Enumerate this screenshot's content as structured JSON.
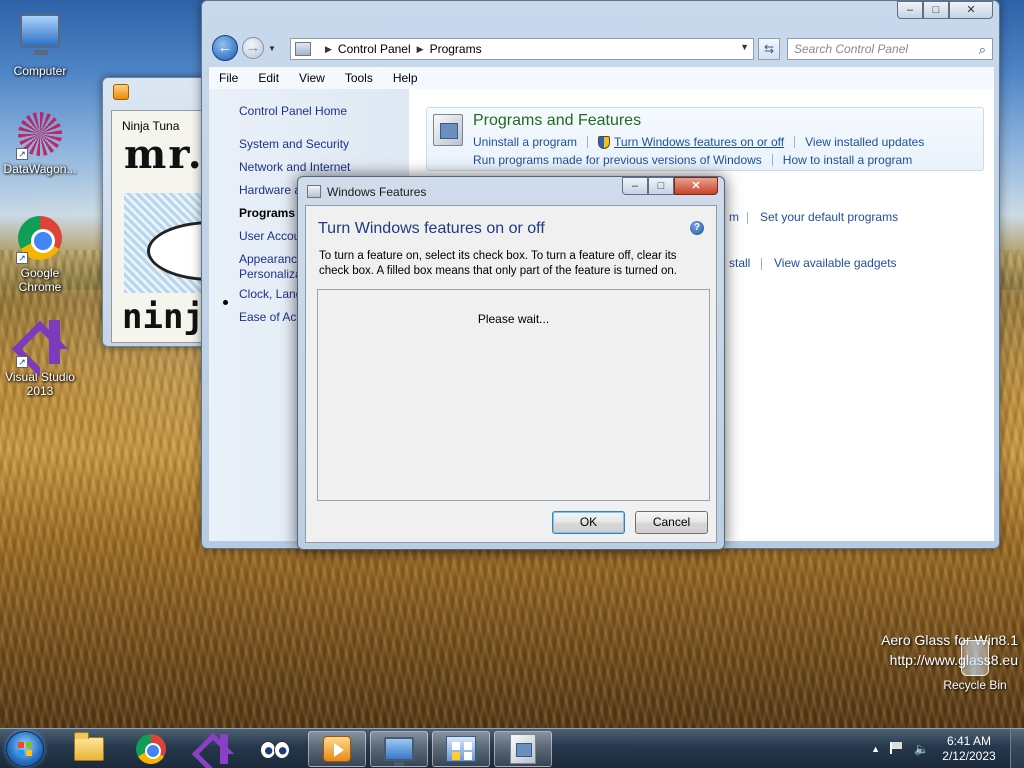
{
  "desktop": {
    "icons": [
      {
        "label": "Computer"
      },
      {
        "label": "DataWagon..."
      },
      {
        "label": "Google Chrome"
      },
      {
        "label": "Visual Studio 2013"
      }
    ],
    "recycle_bin": "Recycle Bin",
    "watermark_line1": "Aero Glass for Win8.1",
    "watermark_line2": "http://www.glass8.eu"
  },
  "media_window": {
    "title": "Ninja Tuna",
    "art_text_top": "mr.s",
    "art_text_bottom": "ninj"
  },
  "control_panel": {
    "breadcrumb": [
      "Control Panel",
      "Programs"
    ],
    "search_placeholder": "Search Control Panel",
    "menu": [
      "File",
      "Edit",
      "View",
      "Tools",
      "Help"
    ],
    "sidebar": {
      "home": "Control Panel Home",
      "items": [
        "System and Security",
        "Network and Internet",
        "Hardware a",
        "Programs",
        "User Accou",
        "Appearanc",
        "Personaliza",
        "Clock, Lang",
        "Ease of Acc"
      ]
    },
    "programs_and_features": {
      "title": "Programs and Features",
      "links_row1": [
        "Uninstall a program",
        "Turn Windows features on or off",
        "View installed updates"
      ],
      "links_row2": [
        "Run programs made for previous versions of Windows",
        "How to install a program"
      ]
    },
    "behind_links": {
      "default_programs_partial": "m",
      "set_default": "Set your default programs",
      "install_partial": "stall",
      "gadgets": "View available gadgets"
    }
  },
  "windows_features": {
    "title": "Windows Features",
    "heading": "Turn Windows features on or off",
    "description": "To turn a feature on, select its check box. To turn a feature off, clear its check box. A filled box means that only part of the feature is turned on.",
    "status": "Please wait...",
    "ok_label": "OK",
    "cancel_label": "Cancel"
  },
  "taskbar": {
    "time": "6:41 AM",
    "date": "2/12/2023",
    "apps": [
      "explorer",
      "chrome",
      "visual-studio",
      "eyes",
      "media-player",
      "remote-desktop",
      "control-panel",
      "windows-features"
    ]
  }
}
